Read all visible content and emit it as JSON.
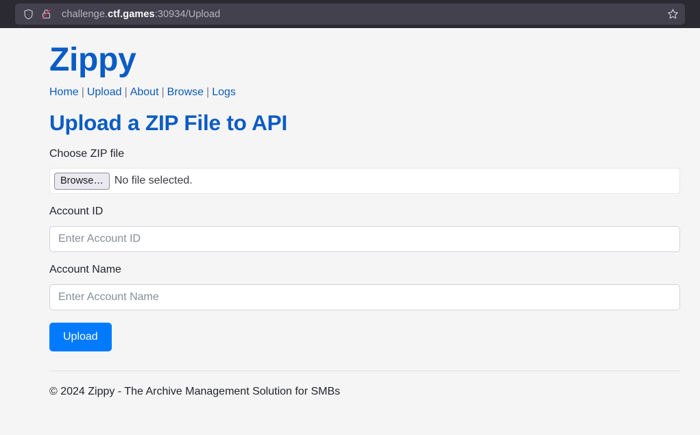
{
  "browser": {
    "shield_icon": "shield-icon",
    "lock_icon": "lock-crossed-icon",
    "bookmark_icon": "star-icon",
    "url": {
      "prefix": "challenge.",
      "domain": "ctf.games",
      "suffix": ":30934/Upload"
    }
  },
  "site": {
    "title": "Zippy",
    "nav": [
      {
        "label": "Home"
      },
      {
        "label": "Upload"
      },
      {
        "label": "About"
      },
      {
        "label": "Browse"
      },
      {
        "label": "Logs"
      }
    ],
    "nav_separator": "|"
  },
  "main": {
    "heading": "Upload a ZIP File to API",
    "file_field": {
      "label": "Choose ZIP file",
      "browse_label": "Browse…",
      "status": "No file selected."
    },
    "account_id": {
      "label": "Account ID",
      "placeholder": "Enter Account ID",
      "value": ""
    },
    "account_name": {
      "label": "Account Name",
      "placeholder": "Enter Account Name",
      "value": ""
    },
    "submit_label": "Upload"
  },
  "footer": {
    "text": "© 2024 Zippy - The Archive Management Solution for SMBs"
  },
  "colors": {
    "link": "#0d5cb6",
    "heading": "#0b5cc4",
    "primary_button": "#007bff",
    "page_background": "#f5f5f6",
    "chrome_background": "#2b2a33"
  }
}
